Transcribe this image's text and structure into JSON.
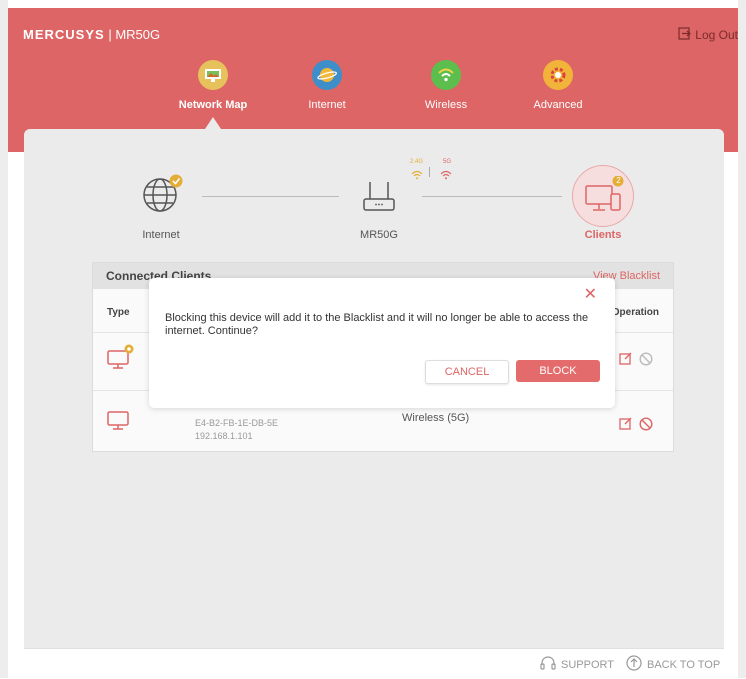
{
  "header": {
    "brand": "MERCUSYS",
    "model": "MR50G",
    "logout_label": "Log Out"
  },
  "nav": {
    "items": [
      {
        "label": "Network Map",
        "icon": "network-map-icon"
      },
      {
        "label": "Internet",
        "icon": "internet-globe-icon"
      },
      {
        "label": "Wireless",
        "icon": "wireless-icon"
      },
      {
        "label": "Advanced",
        "icon": "advanced-gear-icon"
      }
    ],
    "active": "Network Map"
  },
  "topology": {
    "internet_label": "Internet",
    "router_label": "MR50G",
    "clients_label": "Clients",
    "band_24": "2.4G",
    "band_5": "5G",
    "client_count": "2"
  },
  "clients_table": {
    "title": "Connected Clients",
    "blacklist_link": "View Blacklist",
    "col_type": "Type",
    "col_operation": "Operation",
    "rows": [
      {
        "name": "",
        "mac": "",
        "ip": "",
        "connection": ""
      },
      {
        "name": "***",
        "mac": "E4-B2-FB-1E-DB-5E",
        "ip": "192.168.1.101",
        "connection": "Wireless (5G)"
      }
    ]
  },
  "dialog": {
    "message": "Blocking this device will add it to the Blacklist and it will no longer be able to access the internet. Continue?",
    "cancel_label": "CANCEL",
    "block_label": "BLOCK"
  },
  "footer": {
    "support_label": "SUPPORT",
    "back_to_top_label": "BACK TO TOP"
  },
  "colors": {
    "accent": "#dd6565",
    "panel_bg": "#ebebeb"
  }
}
